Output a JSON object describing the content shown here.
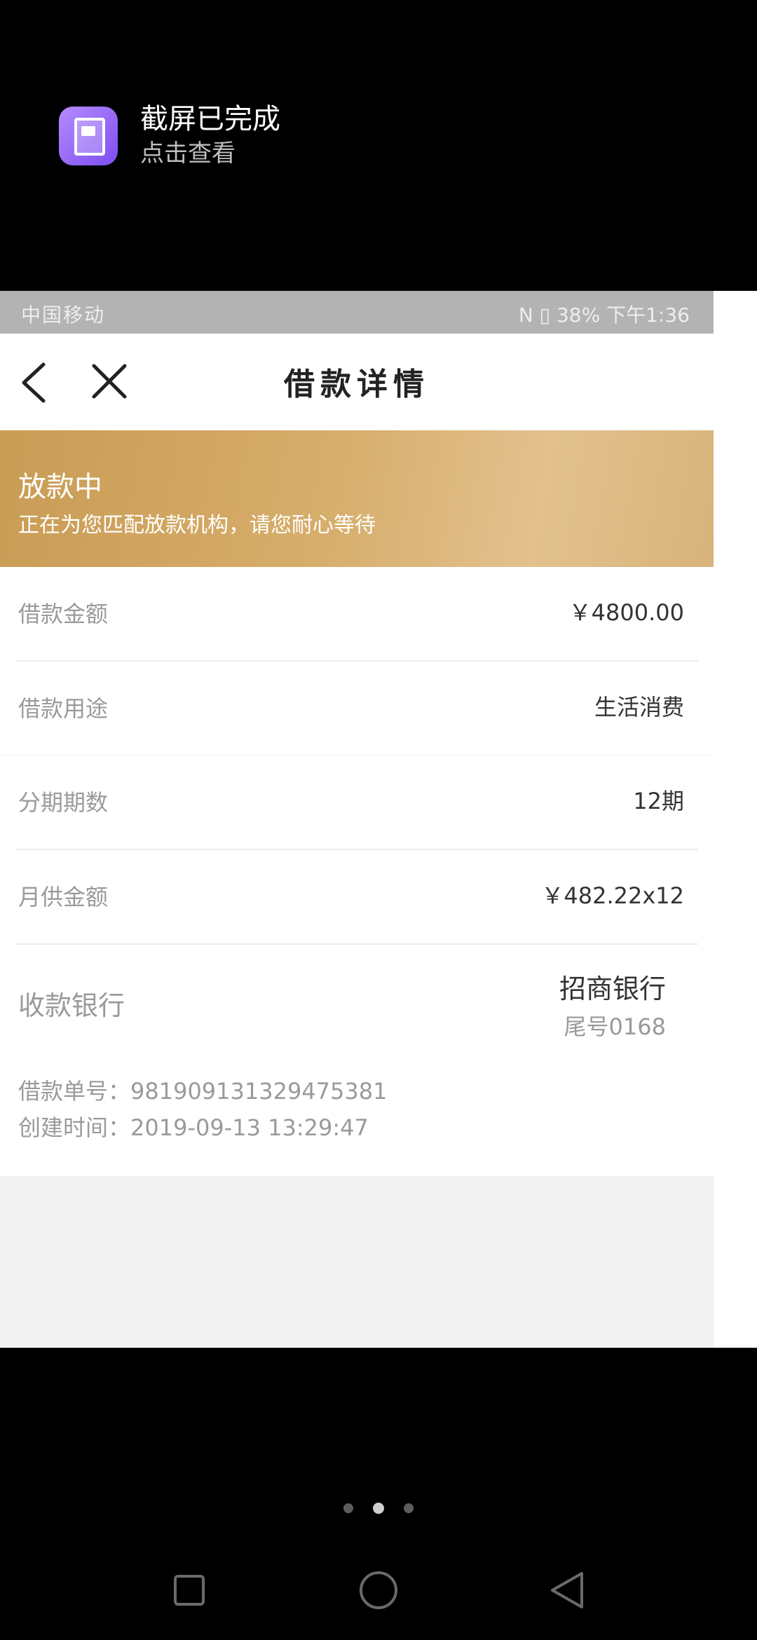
{
  "notification": {
    "title": "截屏已完成",
    "subtitle": "点击查看"
  },
  "status_bar": {
    "carrier": "中国移动",
    "right_text": "Ν ▯ 38%  下午1:36"
  },
  "navbar": {
    "title": "借款详情"
  },
  "banner": {
    "title": "放款中",
    "subtitle": "正在为您匹配放款机构，请您耐心等待"
  },
  "details": {
    "rows1": [
      {
        "label": "借款金额",
        "value": "￥4800.00"
      },
      {
        "label": "借款用途",
        "value": "生活消费"
      }
    ],
    "rows2": [
      {
        "label": "分期期数",
        "value": "12期"
      },
      {
        "label": "月供金额",
        "value": "￥482.22x12"
      }
    ],
    "bank": {
      "label": "收款银行",
      "name": "招商银行",
      "tail": "尾号0168"
    }
  },
  "meta": {
    "order": "借款单号：981909131329475381",
    "created": "创建时间：2019-09-13 13:29:47"
  }
}
